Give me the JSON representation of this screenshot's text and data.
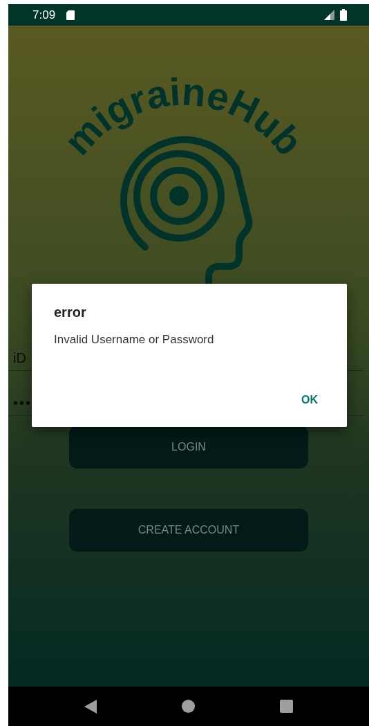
{
  "status_bar": {
    "time": "7:09"
  },
  "logo": {
    "text": "migraineHub"
  },
  "fields": [
    {
      "kind": "text",
      "value": "iD"
    },
    {
      "kind": "password",
      "value": "•••"
    }
  ],
  "buttons": [
    {
      "label": "LOGIN"
    },
    {
      "label": "CREATE ACCOUNT"
    }
  ],
  "dialog": {
    "title": "error",
    "message": "Invalid Username or Password",
    "button": "OK"
  }
}
